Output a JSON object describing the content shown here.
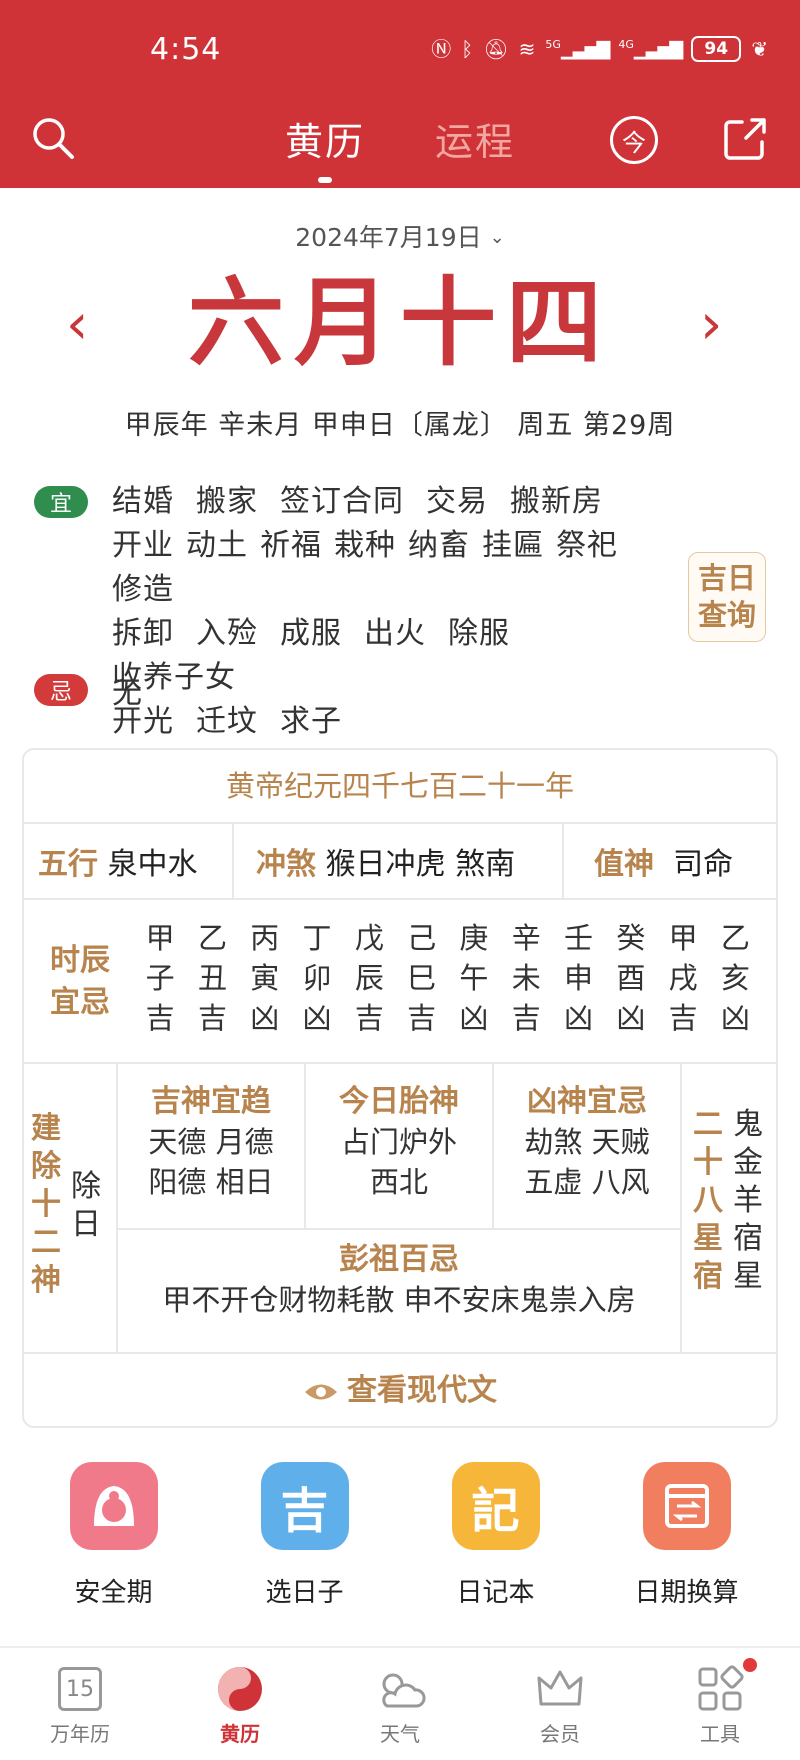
{
  "status_bar": {
    "time": "4:54",
    "battery": "94",
    "signal_a": "5G",
    "signal_b": "4G"
  },
  "nav": {
    "tabs": [
      "黄历",
      "运程"
    ],
    "today_icon": "今"
  },
  "date": {
    "selector": "2024年7月19日",
    "lunar": "六月十四",
    "ganzhi": "甲辰年 辛未月 甲申日〔属龙〕 周五 第29周"
  },
  "yi": {
    "badge": "宜",
    "items": [
      "结婚",
      "搬家",
      "签订合同",
      "交易",
      "搬新房",
      "开业",
      "动土",
      "祈福",
      "栽种",
      "纳畜",
      "挂匾",
      "祭祀",
      "修造",
      "拆卸",
      "入殓",
      "成服",
      "出火",
      "除服",
      "收养子女",
      "开光",
      "迁坟",
      "求子"
    ]
  },
  "ji": {
    "badge": "忌",
    "text": "无"
  },
  "jiri_button": "吉日查询",
  "card": {
    "era": "黄帝纪元四千七百二十一年",
    "wuxing": {
      "label": "五行",
      "value": "泉中水"
    },
    "chongsha": {
      "label": "冲煞",
      "value": "猴日冲虎 煞南"
    },
    "zhishen": {
      "label": "值神",
      "value": "司命"
    },
    "shichen": {
      "label": "时辰宜忌",
      "gan": [
        "甲",
        "乙",
        "丙",
        "丁",
        "戊",
        "己",
        "庚",
        "辛",
        "壬",
        "癸",
        "甲",
        "乙"
      ],
      "zhi": [
        "子",
        "丑",
        "寅",
        "卯",
        "辰",
        "巳",
        "午",
        "未",
        "申",
        "酉",
        "戌",
        "亥"
      ],
      "luck": [
        "吉",
        "吉",
        "凶",
        "凶",
        "吉",
        "吉",
        "凶",
        "吉",
        "凶",
        "凶",
        "吉",
        "凶"
      ]
    },
    "jianchu": {
      "label": "建除十二神",
      "value": "除日"
    },
    "jishen": {
      "title": "吉神宜趋",
      "line1": "天德 月德",
      "line2": "阳德 相日"
    },
    "taishen": {
      "title": "今日胎神",
      "line1": "占门炉外",
      "line2": "西北"
    },
    "xiongshen": {
      "title": "凶神宜忌",
      "line1": "劫煞 天贼",
      "line2": "五虚 八风"
    },
    "xiu": {
      "label": "二十八星宿",
      "value": "鬼金羊宿星"
    },
    "pengzu": {
      "title": "彭祖百忌",
      "text": "甲不开仓财物耗散 申不安床鬼祟入房"
    },
    "modern": "查看现代文"
  },
  "tools": [
    {
      "label": "安全期",
      "icon": "flower-girl-icon",
      "color": "#f07a8a"
    },
    {
      "label": "选日子",
      "icon_text": "吉",
      "color": "#5fb0ea"
    },
    {
      "label": "日记本",
      "icon_text": "記",
      "color": "#f5b63a"
    },
    {
      "label": "日期换算",
      "icon": "calendar-convert-icon",
      "color": "#f27e60"
    }
  ],
  "bottom_nav": [
    {
      "label": "万年历",
      "icon_text": "15"
    },
    {
      "label": "黄历"
    },
    {
      "label": "天气"
    },
    {
      "label": "会员"
    },
    {
      "label": "工具"
    }
  ]
}
